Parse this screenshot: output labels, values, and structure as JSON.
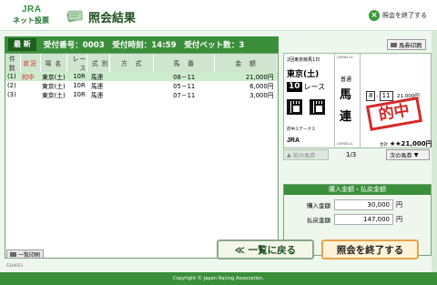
{
  "header": {
    "logo_top": "JRA",
    "logo_bottom": "ネット投票",
    "title": "照会結果",
    "end_link": "照会を終了する"
  },
  "info": {
    "badge": "最 新",
    "text": "受付番号：0003　受付時刻：14:59　受付ベット数：3"
  },
  "table": {
    "headers": [
      "件数",
      "状況",
      "場 名",
      "レース",
      "式 別",
      "方　式",
      "馬　番",
      "金　額"
    ],
    "rows": [
      {
        "no": "(1)",
        "status": "的中",
        "place": "東京(土)",
        "race": "10R",
        "type": "馬連",
        "method": "",
        "nums": "08－11",
        "amount": "21,000円"
      },
      {
        "no": "(2)",
        "status": "",
        "place": "東京(土)",
        "race": "10R",
        "type": "馬連",
        "method": "",
        "nums": "05－11",
        "amount": "6,000円"
      },
      {
        "no": "(3)",
        "status": "",
        "place": "東京(土)",
        "race": "10R",
        "type": "馬連",
        "method": "",
        "nums": "07－11",
        "amount": "3,000円"
      }
    ],
    "print_label": "一覧印刷"
  },
  "ticket": {
    "print_label": "馬券印刷",
    "header_line": "2回東京競馬1日",
    "place": "東京(土)",
    "race_no": "10",
    "race_label": "レース",
    "quinella": "QUINELLA",
    "futsu": "普通",
    "bet_char1": "馬",
    "bet_char2": "連",
    "horse1": "8",
    "horse2": "11",
    "amount": "21,000円",
    "stakes": "府中ステークス",
    "jra": "JRA",
    "total_label": "合計",
    "total": "★★21,000円",
    "stamp": "的中",
    "prev_label": "前の馬券",
    "page": "1/3",
    "next_label": "次の馬券"
  },
  "summary": {
    "title": "購入金額・払戻金額",
    "purchase_label": "購入金額",
    "purchase_value": "30,000",
    "payout_label": "払戻金額",
    "payout_value": "147,000",
    "unit": "円"
  },
  "buttons": {
    "back": "≪ 一覧に戻る",
    "end": "照会を終了する"
  },
  "version": "S344053",
  "footer": "Copyright © Japan Racing Association."
}
